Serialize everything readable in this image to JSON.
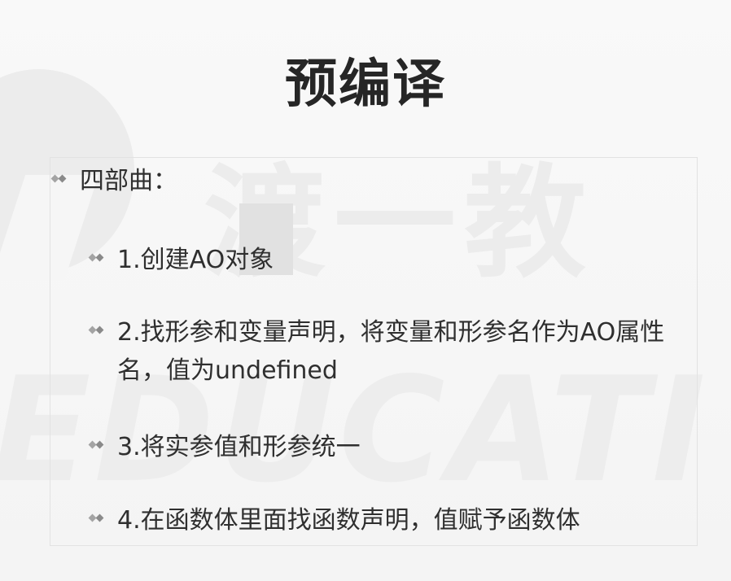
{
  "slide": {
    "title": "预编译",
    "bullets": [
      {
        "level": 1,
        "text": "四部曲："
      },
      {
        "level": 2,
        "text": "1.创建AO对象"
      },
      {
        "level": 2,
        "text": "2.找形参和变量声明，将变量和形参名作为AO属性名，值为undefined"
      },
      {
        "level": 2,
        "text": "3.将实参值和形参统一"
      },
      {
        "level": 2,
        "text": "4.在函数体里面找函数声明，值赋予函数体"
      }
    ]
  },
  "watermark": {
    "cn_text": "渡一教",
    "en_text": "EDUCATI"
  },
  "colors": {
    "background": "#f7f7f7",
    "text": "#2c2c2c",
    "bullet": "#a4a4a4",
    "watermark": "#ececec"
  }
}
